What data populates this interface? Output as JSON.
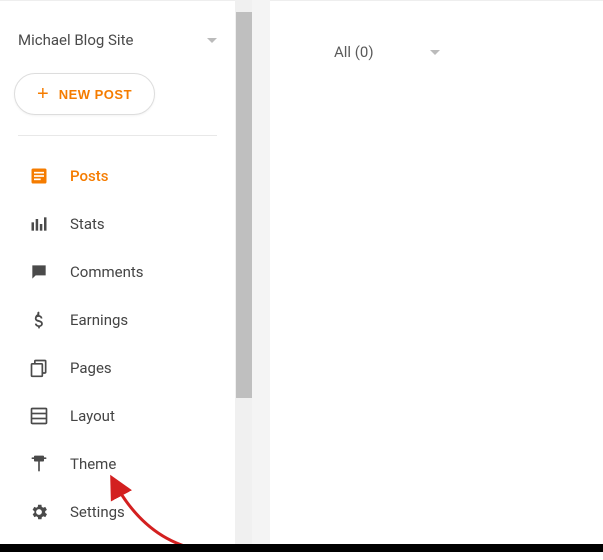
{
  "blog": {
    "title": "Michael Blog Site"
  },
  "newPost": {
    "label": "NEW POST"
  },
  "nav": {
    "items": [
      {
        "name": "posts",
        "label": "Posts",
        "active": true
      },
      {
        "name": "stats",
        "label": "Stats",
        "active": false
      },
      {
        "name": "comments",
        "label": "Comments",
        "active": false
      },
      {
        "name": "earnings",
        "label": "Earnings",
        "active": false
      },
      {
        "name": "pages",
        "label": "Pages",
        "active": false
      },
      {
        "name": "layout",
        "label": "Layout",
        "active": false
      },
      {
        "name": "theme",
        "label": "Theme",
        "active": false
      },
      {
        "name": "settings",
        "label": "Settings",
        "active": false
      }
    ]
  },
  "filter": {
    "label": "All (0)"
  }
}
